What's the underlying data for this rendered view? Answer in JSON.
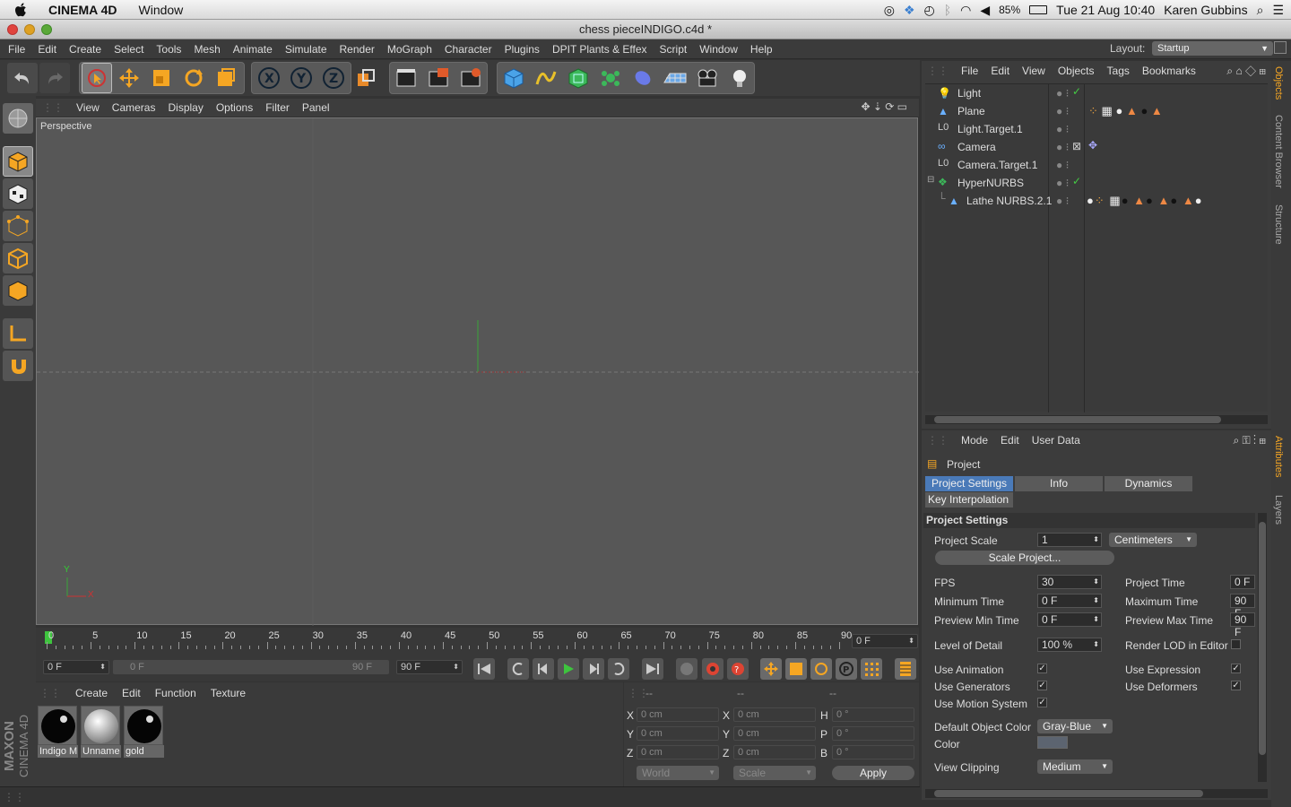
{
  "mac_menubar": {
    "app_name": "CINEMA 4D",
    "window_menu": "Window",
    "battery": "85%",
    "datetime": "Tue 21 Aug  10:40",
    "user": "Karen Gubbins"
  },
  "window": {
    "title": "chess pieceINDIGO.c4d *"
  },
  "menu": [
    "File",
    "Edit",
    "Create",
    "Select",
    "Tools",
    "Mesh",
    "Animate",
    "Simulate",
    "Render",
    "MoGraph",
    "Character",
    "Plugins",
    "DPIT Plants & Effex",
    "Script",
    "Window",
    "Help"
  ],
  "layout": {
    "label": "Layout:",
    "value": "Startup"
  },
  "viewport": {
    "menu": [
      "View",
      "Cameras",
      "Display",
      "Options",
      "Filter",
      "Panel"
    ],
    "label": "Perspective",
    "axis_y": "Y",
    "axis_x": "X"
  },
  "timeline": {
    "ticks": [
      "0",
      "5",
      "10",
      "15",
      "20",
      "25",
      "30",
      "35",
      "40",
      "45",
      "50",
      "55",
      "60",
      "65",
      "70",
      "75",
      "80",
      "85",
      "90"
    ],
    "current_frame": "0 F"
  },
  "transport": {
    "start": "0 F",
    "range_start": "0 F",
    "range_end": "90 F",
    "end": "90 F"
  },
  "material_manager": {
    "menu": [
      "Create",
      "Edit",
      "Function",
      "Texture"
    ],
    "materials": [
      "Indigo M",
      "Unname",
      "gold"
    ]
  },
  "coordinates": {
    "headers": [
      "--",
      "--",
      "--"
    ],
    "rows": [
      {
        "a": "X",
        "av": "0 cm",
        "b": "X",
        "bv": "0 cm",
        "c": "H",
        "cv": "0 °"
      },
      {
        "a": "Y",
        "av": "0 cm",
        "b": "Y",
        "bv": "0 cm",
        "c": "P",
        "cv": "0 °"
      },
      {
        "a": "Z",
        "av": "0 cm",
        "b": "Z",
        "bv": "0 cm",
        "c": "B",
        "cv": "0 °"
      }
    ],
    "mode1": "World",
    "mode2": "Scale",
    "apply": "Apply"
  },
  "object_manager": {
    "menu": [
      "File",
      "Edit",
      "View",
      "Objects",
      "Tags",
      "Bookmarks"
    ],
    "objects": [
      "Light",
      "Plane",
      "Light.Target.1",
      "Camera",
      "Camera.Target.1",
      "HyperNURBS",
      "Lathe NURBS.2.1"
    ]
  },
  "attributes": {
    "menu": [
      "Mode",
      "Edit",
      "User Data"
    ],
    "object": "Project",
    "tabs": [
      "Project Settings",
      "Info",
      "Dynamics",
      "Key Interpolation"
    ],
    "section": "Project Settings",
    "project_scale_label": "Project Scale",
    "project_scale": "1",
    "units": "Centimeters",
    "scale_button": "Scale Project...",
    "fps_label": "FPS",
    "fps": "30",
    "project_time_label": "Project Time",
    "project_time": "0 F",
    "min_time_label": "Minimum Time",
    "min_time": "0 F",
    "max_time_label": "Maximum Time",
    "max_time": "90 F",
    "prev_min_label": "Preview Min Time",
    "prev_min": "0 F",
    "prev_max_label": "Preview Max Time",
    "prev_max": "90 F",
    "lod_label": "Level of Detail",
    "lod": "100 %",
    "render_lod_label": "Render LOD in Editor",
    "use_animation": "Use Animation",
    "use_expression": "Use Expression",
    "use_generators": "Use Generators",
    "use_deformers": "Use Deformers",
    "use_motion": "Use Motion System",
    "default_color_label": "Default Object Color",
    "default_color": "Gray-Blue",
    "color_label": "Color",
    "view_clipping_label": "View Clipping",
    "view_clipping": "Medium"
  },
  "side_tabs": [
    "Objects",
    "Content Browser",
    "Structure",
    "Attributes",
    "Layers"
  ],
  "brand": [
    "MAXON",
    "CINEMA 4D"
  ]
}
